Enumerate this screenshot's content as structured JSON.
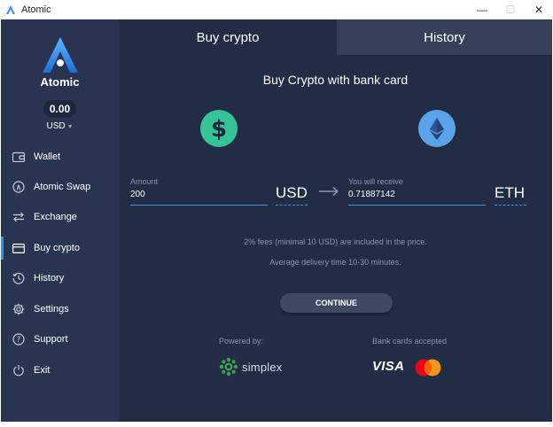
{
  "window": {
    "title": "Atomic",
    "minimize": "—",
    "maximize": "☐",
    "close": "✕"
  },
  "sidebar": {
    "brand": "Atomic",
    "balance": "0.00",
    "currency": "USD",
    "items": [
      {
        "label": "Wallet",
        "icon": "wallet-icon"
      },
      {
        "label": "Atomic Swap",
        "icon": "atomic-swap-icon"
      },
      {
        "label": "Exchange",
        "icon": "exchange-icon"
      },
      {
        "label": "Buy crypto",
        "icon": "card-icon",
        "active": true
      },
      {
        "label": "History",
        "icon": "history-icon"
      },
      {
        "label": "Settings",
        "icon": "gear-icon"
      },
      {
        "label": "Support",
        "icon": "help-icon"
      },
      {
        "label": "Exit",
        "icon": "power-icon"
      }
    ]
  },
  "tabs": {
    "buy": "Buy crypto",
    "history": "History"
  },
  "main": {
    "heading": "Buy Crypto with bank card",
    "amount": {
      "label": "Amount",
      "value": "200",
      "unit": "USD"
    },
    "receive": {
      "label": "You will receive",
      "value": "0.71887142",
      "unit": "ETH"
    },
    "fees_note": "2% fees (minimal 10 USD) are included in the price.",
    "delivery_note": "Average delivery time 10-30 minutes.",
    "continue_label": "CONTINUE",
    "powered_by": "Powered by:",
    "provider": "simplex",
    "cards_label": "Bank cards accepted",
    "visa": "VISA"
  },
  "colors": {
    "accent": "#4a90e2",
    "usd_coin": "#35c498",
    "eth_coin": "#5aa3ea",
    "mastercard_red": "#eb001b",
    "mastercard_orange": "#f79e1b"
  }
}
